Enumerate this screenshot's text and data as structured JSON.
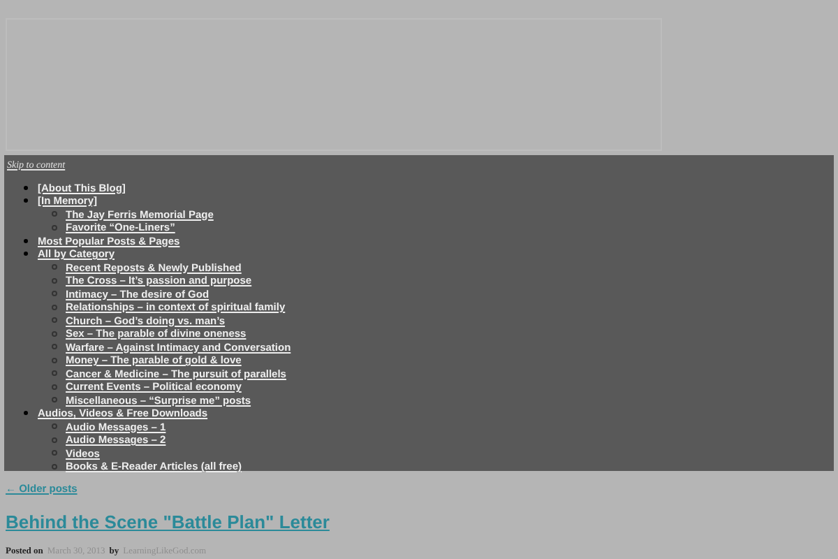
{
  "skip_link": "Skip to content",
  "nav": [
    {
      "label": "[About This Blog]"
    },
    {
      "label": "[In Memory]",
      "children": [
        {
          "label": "The Jay Ferris Memorial Page"
        },
        {
          "label": "Favorite “One-Liners”"
        }
      ]
    },
    {
      "label": "Most Popular Posts & Pages"
    },
    {
      "label": "All by Category",
      "children": [
        {
          "label": "Recent Reposts & Newly Published"
        },
        {
          "label": "The Cross – It’s passion and purpose"
        },
        {
          "label": "Intimacy – The desire of God"
        },
        {
          "label": "Relationships – in context of spiritual family"
        },
        {
          "label": "Church – God’s doing vs. man’s"
        },
        {
          "label": "Sex – The parable of divine oneness"
        },
        {
          "label": "Warfare – Against Intimacy and Conversation"
        },
        {
          "label": "Money – The parable of gold & love"
        },
        {
          "label": "Cancer & Medicine – The pursuit of parallels"
        },
        {
          "label": "Current Events – Political economy"
        },
        {
          "label": "Miscellaneous – “Surprise me” posts"
        }
      ]
    },
    {
      "label": "Audios, Videos & Free Downloads",
      "children": [
        {
          "label": "Audio Messages – 1"
        },
        {
          "label": "Audio Messages – 2"
        },
        {
          "label": "Videos"
        },
        {
          "label": "Books & E-Reader Articles (all free)"
        }
      ]
    }
  ],
  "older_posts": "← Older posts",
  "post": {
    "title": "Behind the Scene \"Battle Plan\" Letter",
    "posted_on": "Posted on",
    "date": "March 30, 2013",
    "by": "by",
    "author": "LearningLikeGod.com"
  }
}
